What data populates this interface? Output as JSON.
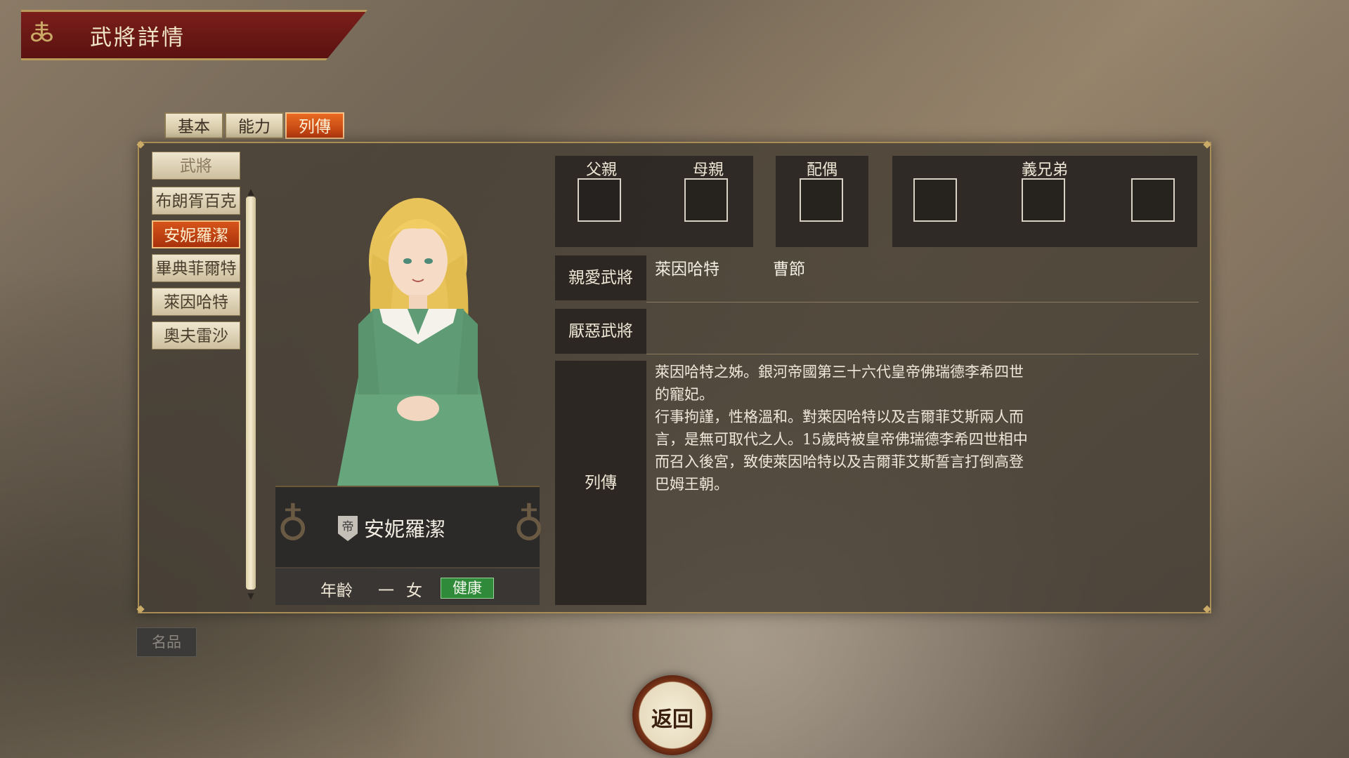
{
  "window": {
    "title": "武將詳情"
  },
  "tabs": [
    {
      "label": "基本",
      "active": false
    },
    {
      "label": "能力",
      "active": false
    },
    {
      "label": "列傳",
      "active": true
    }
  ],
  "list": {
    "header": "武將",
    "items": [
      {
        "label": "布朗胥百克",
        "selected": false
      },
      {
        "label": "安妮羅潔",
        "selected": true
      },
      {
        "label": "畢典菲爾特",
        "selected": false
      },
      {
        "label": "萊因哈特",
        "selected": false
      },
      {
        "label": "奧夫雷沙",
        "selected": false
      }
    ]
  },
  "character": {
    "name": "安妮羅潔",
    "faction_icon_text": "帝",
    "age_label": "年齡",
    "age_value": "一",
    "gender": "女",
    "health": "健康"
  },
  "relations": {
    "father": "父親",
    "mother": "母親",
    "spouse": "配偶",
    "sworn": "義兄弟"
  },
  "rows": {
    "favored_label": "親愛武將",
    "favored": [
      "萊因哈特",
      "曹節"
    ],
    "disliked_label": "厭惡武將",
    "bio_label": "列傳",
    "bio": "萊因哈特之姊。銀河帝國第三十六代皇帝佛瑞德李希四世\n的寵妃。\n行事拘謹，性格溫和。對萊因哈特以及吉爾菲艾斯兩人而\n言，是無可取代之人。15歲時被皇帝佛瑞德李希四世相中\n而召入後宮，致使萊因哈特以及吉爾菲艾斯誓言打倒高登\n巴姆王朝。"
  },
  "buttons": {
    "mingpin": "名品",
    "return": "返回"
  },
  "colors": {
    "accent_active": "#d6541a",
    "health_green": "#2f8a3a",
    "frame_gold": "#a98d55"
  }
}
